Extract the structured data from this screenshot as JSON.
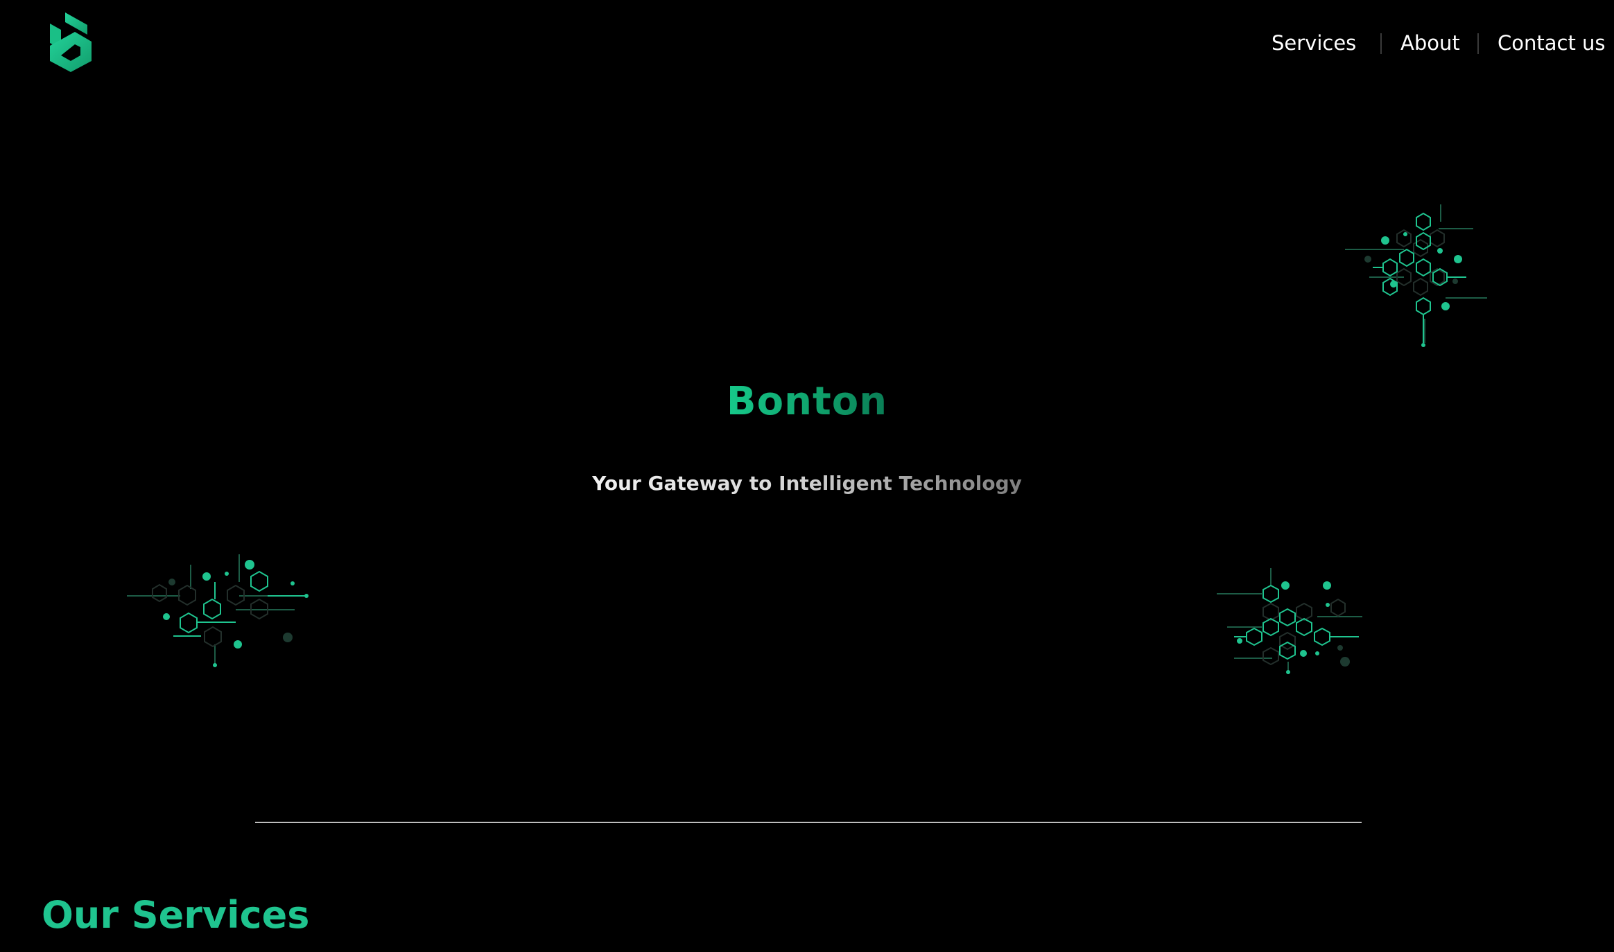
{
  "brand": {
    "logo_icon": "bonton-logo-icon",
    "accent_color": "#1fc48f"
  },
  "nav": {
    "items": [
      {
        "label": "Services"
      },
      {
        "label": "About"
      },
      {
        "label": "Contact us"
      }
    ]
  },
  "hero": {
    "title": "Bonton",
    "subtitle": "Your Gateway to Intelligent Technology",
    "decoration_icon": "hexagon-network-icon"
  },
  "services": {
    "heading": "Our Services"
  }
}
